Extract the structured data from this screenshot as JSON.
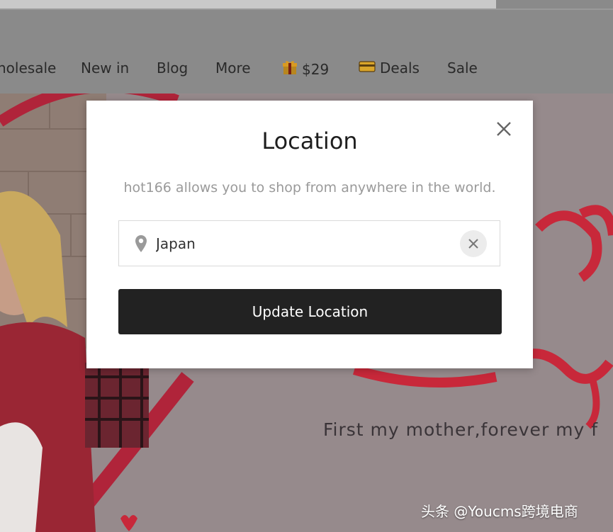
{
  "nav": {
    "items": [
      {
        "label": "holesale"
      },
      {
        "label": "New in"
      },
      {
        "label": "Blog"
      },
      {
        "label": "More"
      },
      {
        "label": "$29",
        "icon": "gift-icon"
      },
      {
        "label": "Deals",
        "icon": "card-icon"
      },
      {
        "label": "Sale"
      }
    ]
  },
  "hero": {
    "tagline": "First my mother,forever my f"
  },
  "modal": {
    "title": "Location",
    "subtitle": "hot166 allows you to shop from anywhere in the world.",
    "location_value": "Japan",
    "button_label": "Update Location"
  },
  "watermark": "头条 @Youcms跨境电商",
  "colors": {
    "button_bg": "#222222",
    "hero_accent": "#c8283a",
    "backdrop": "#8a8a8a"
  }
}
